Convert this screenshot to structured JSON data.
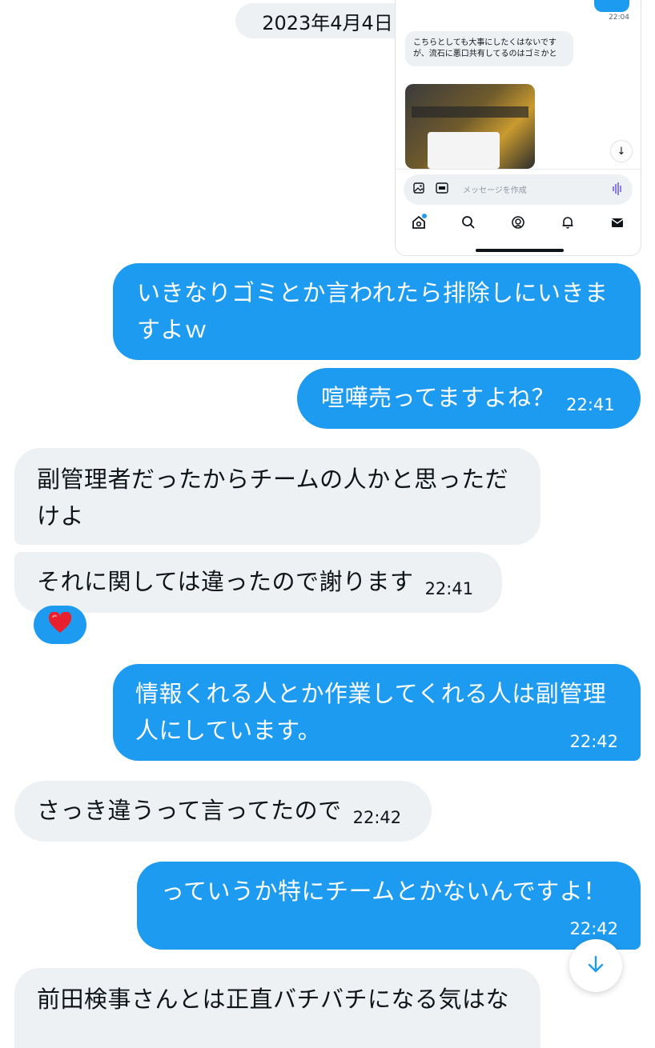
{
  "date_separator": "2023年4月4日",
  "embedded_screenshot": {
    "top_time": "22:04",
    "bubble_text": "こちらとしても大事にしたくはないですが、流石に悪口共有してるのはゴミかと",
    "composer_placeholder": "メッセージを作成",
    "scroll_icon": "arrow-down-icon",
    "nav_icons": [
      "home-icon",
      "search-icon",
      "spaces-icon",
      "bell-icon",
      "mail-icon"
    ]
  },
  "messages": [
    {
      "side": "sent",
      "text": "いきなりゴミとか言われたら排除しにいきますよｗ",
      "time": ""
    },
    {
      "side": "sent",
      "text": "喧嘩売ってますよね？",
      "time": "22:41"
    },
    {
      "side": "received",
      "text": "副管理者だったからチームの人かと思っただけよ",
      "time": ""
    },
    {
      "side": "received",
      "text": "それに関しては違ったので謝ります",
      "time": "22:41",
      "reaction": "❤️"
    },
    {
      "side": "sent",
      "text": "情報くれる人とか作業してくれる人は副管理人にしています。",
      "time": "22:42"
    },
    {
      "side": "received",
      "text": "さっき違うって言ってたので",
      "time": "22:42"
    },
    {
      "side": "sent",
      "text": "っていうか特にチームとかないんですよ！",
      "time": "22:42"
    },
    {
      "side": "received",
      "text": "前田検事さんとは正直バチバチになる気はな",
      "time": ""
    }
  ],
  "scroll_down_button": "arrow-down-icon",
  "colors": {
    "accent": "#1d9bf0",
    "received_bg": "#eef1f3",
    "text": "#0f1419"
  }
}
